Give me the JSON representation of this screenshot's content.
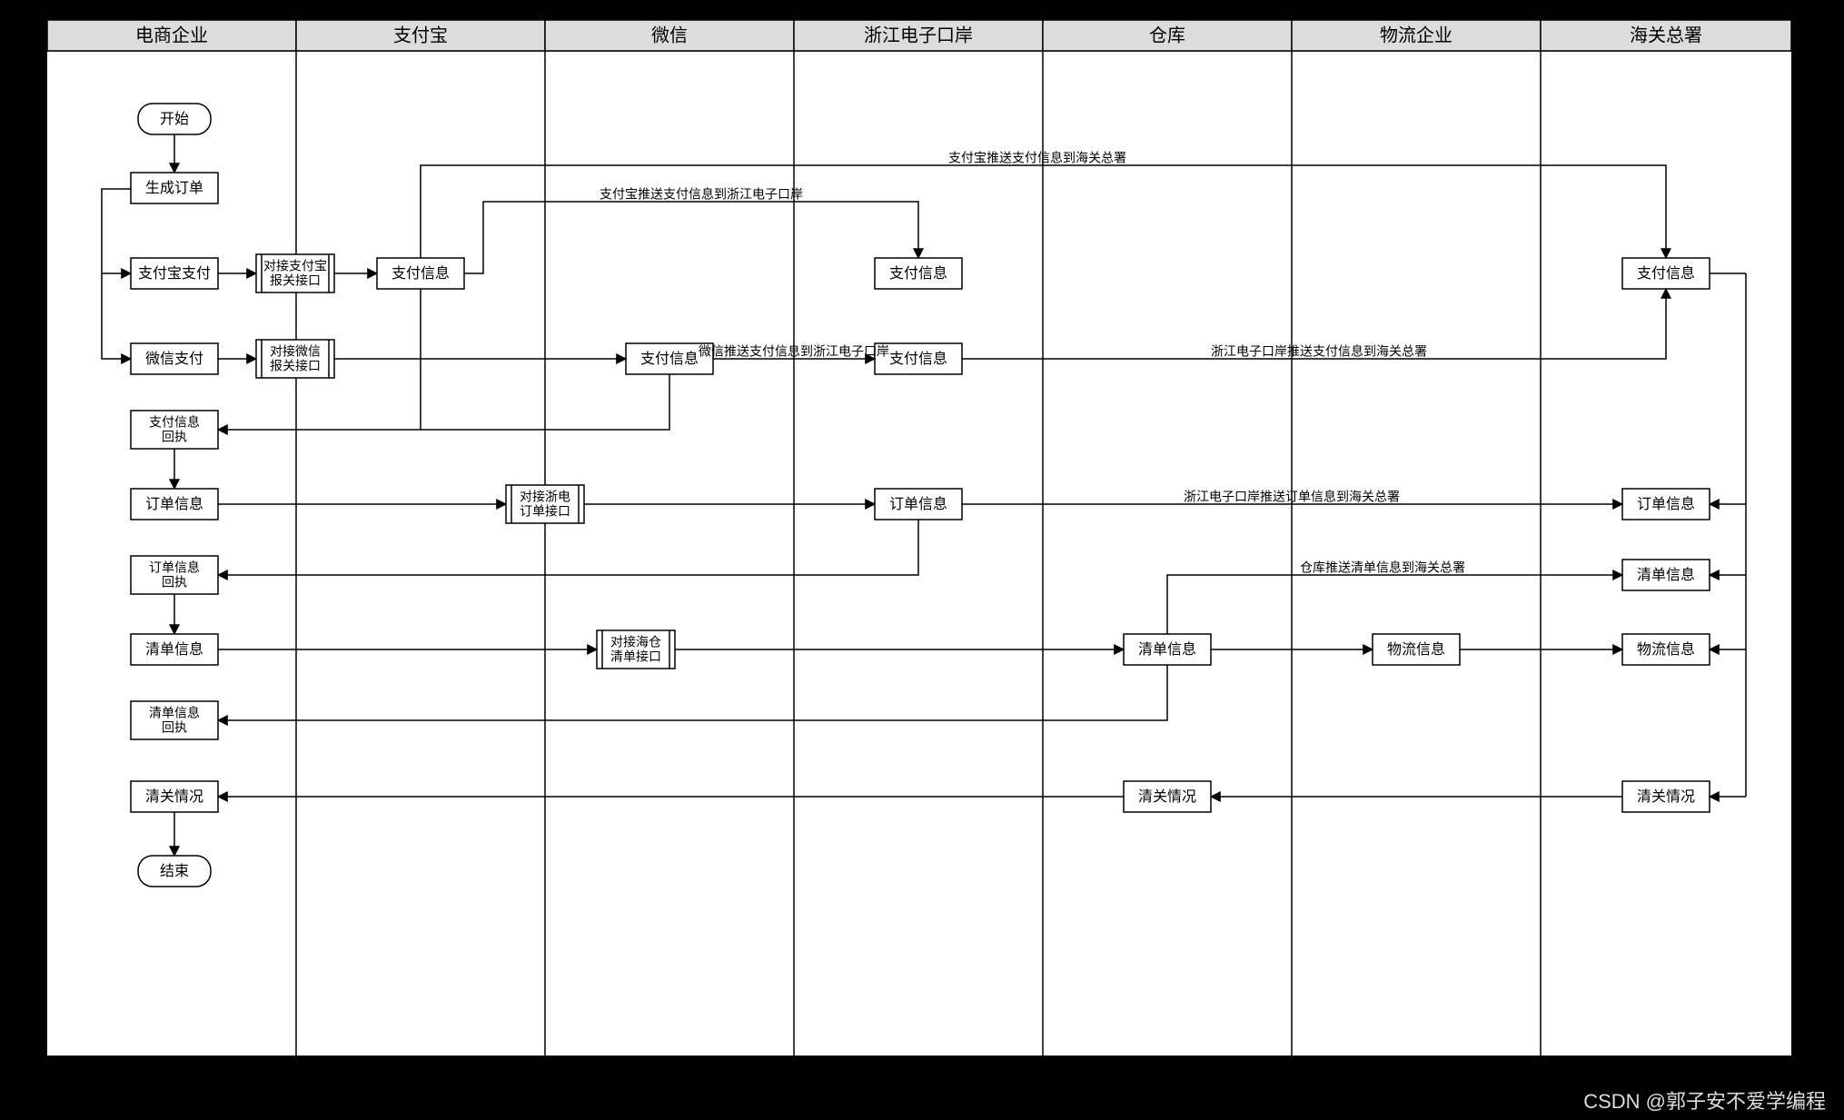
{
  "watermark": "CSDN @郭子安不爱学编程",
  "lanes": [
    "电商企业",
    "支付宝",
    "微信",
    "浙江电子口岸",
    "仓库",
    "物流企业",
    "海关总署"
  ],
  "nodes": {
    "start": "开始",
    "end": "结束",
    "genOrder": "生成订单",
    "alipayPay": "支付宝支付",
    "wechatPay": "微信支付",
    "alipayApi": "对接支付宝\n报关接口",
    "wechatApi": "对接微信\n报关接口",
    "payInfoAli": "支付信息",
    "payInfoWx": "支付信息",
    "payInfoZj1": "支付信息",
    "payInfoZj2": "支付信息",
    "payInfoHG": "支付信息",
    "payReceipt": "支付信息\n回执",
    "orderInfoE": "订单信息",
    "zheOrderApi": "对接浙电\n订单接口",
    "orderInfoZj": "订单信息",
    "orderInfoHG": "订单信息",
    "orderReceipt": "订单信息\n回执",
    "listInfoE": "清单信息",
    "haicangApi": "对接海仓\n清单接口",
    "listInfoCk": "清单信息",
    "listInfoHG": "清单信息",
    "logInfoWl": "物流信息",
    "logInfoHG": "物流信息",
    "listReceipt": "清单信息\n回执",
    "clearE": "清关情况",
    "clearCk": "清关情况",
    "clearHG": "清关情况"
  },
  "edgeLabels": {
    "aliToHG": "支付宝推送支付信息到海关总署",
    "aliToZj": "支付宝推送支付信息到浙江电子口岸",
    "wxToZj": "微信推送支付信息到浙江电子口岸",
    "zjToHG": "浙江电子口岸推送支付信息到海关总署",
    "zjOrderToHG": "浙江电子口岸推送订单信息到海关总署",
    "ckListToHG": "仓库推送清单信息到海关总署"
  }
}
